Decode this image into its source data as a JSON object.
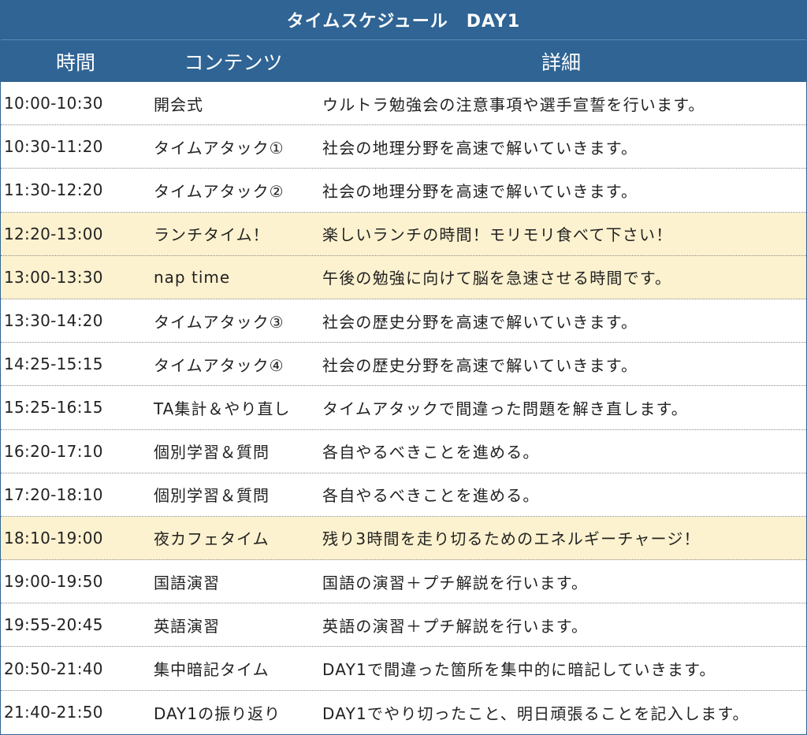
{
  "header": {
    "title": "タイムスケジュール　DAY1",
    "col_time": "時間",
    "col_content": "コンテンツ",
    "col_detail": "詳細"
  },
  "colors": {
    "header_bg": "#2f6494",
    "highlight_bg": "#fdf2cf",
    "row_bg": "#ffffff"
  },
  "rows": [
    {
      "time": "10:00-10:30",
      "content": "開会式",
      "detail": "ウルトラ勉強会の注意事項や選手宣誓を行います。",
      "highlight": false
    },
    {
      "time": "10:30-11:20",
      "content": "タイムアタック①",
      "detail": "社会の地理分野を高速で解いていきます。",
      "highlight": false
    },
    {
      "time": "11:30-12:20",
      "content": "タイムアタック②",
      "detail": "社会の地理分野を高速で解いていきます。",
      "highlight": false
    },
    {
      "time": "12:20-13:00",
      "content": "ランチタイム！",
      "detail": "楽しいランチの時間！モリモリ食べて下さい！",
      "highlight": true
    },
    {
      "time": "13:00-13:30",
      "content": "nap time",
      "detail": "午後の勉強に向けて脳を急速させる時間です。",
      "highlight": true
    },
    {
      "time": "13:30-14:20",
      "content": "タイムアタック③",
      "detail": "社会の歴史分野を高速で解いていきます。",
      "highlight": false
    },
    {
      "time": "14:25-15:15",
      "content": "タイムアタック④",
      "detail": "社会の歴史分野を高速で解いていきます。",
      "highlight": false
    },
    {
      "time": "15:25-16:15",
      "content": "TA集計＆やり直し",
      "detail": "タイムアタックで間違った問題を解き直します。",
      "highlight": false
    },
    {
      "time": "16:20-17:10",
      "content": "個別学習＆質問",
      "detail": "各自やるべきことを進める。",
      "highlight": false
    },
    {
      "time": "17:20-18:10",
      "content": "個別学習＆質問",
      "detail": "各自やるべきことを進める。",
      "highlight": false
    },
    {
      "time": "18:10-19:00",
      "content": "夜カフェタイム",
      "detail": "残り3時間を走り切るためのエネルギーチャージ！",
      "highlight": true
    },
    {
      "time": "19:00-19:50",
      "content": "国語演習",
      "detail": "国語の演習＋プチ解説を行います。",
      "highlight": false
    },
    {
      "time": "19:55-20:45",
      "content": "英語演習",
      "detail": "英語の演習＋プチ解説を行います。",
      "highlight": false
    },
    {
      "time": "20:50-21:40",
      "content": "集中暗記タイム",
      "detail": "DAY1で間違った箇所を集中的に暗記していきます。",
      "highlight": false
    },
    {
      "time": "21:40-21:50",
      "content": "DAY1の振り返り",
      "detail": "DAY1でやり切ったこと、明日頑張ることを記入します。",
      "highlight": false
    }
  ]
}
